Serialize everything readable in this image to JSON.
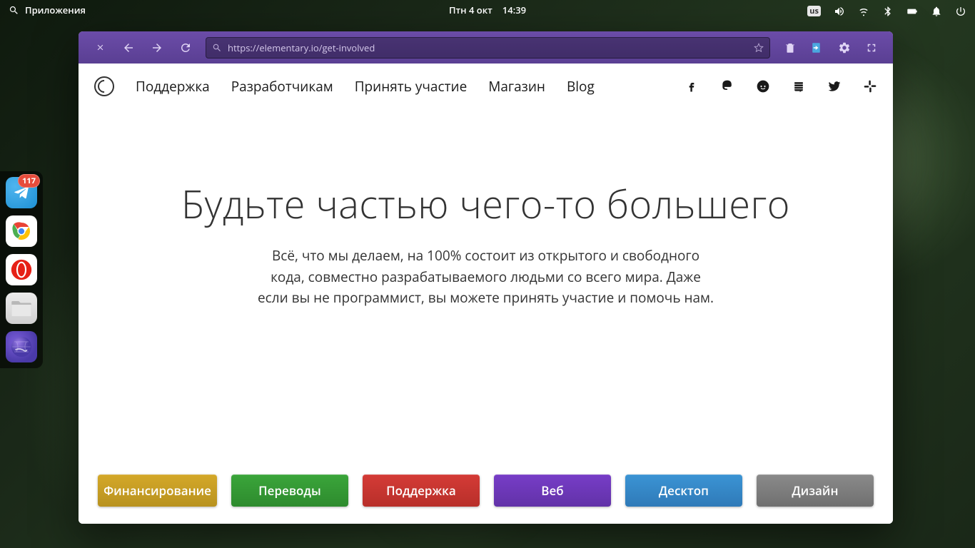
{
  "panel": {
    "apps_label": "Приложения",
    "date": "Птн  4 окт",
    "time": "14:39",
    "keyboard": "us"
  },
  "dock": {
    "telegram_badge": "117"
  },
  "browser": {
    "url": "https://elementary.io/get-involved"
  },
  "site": {
    "nav": {
      "support": "Поддержка",
      "developers": "Разработчикам",
      "get_involved": "Принять участие",
      "store": "Магазин",
      "blog": "Blog"
    },
    "hero": {
      "title": "Будьте частью чего-то большего",
      "subtitle": "Всё, что мы делаем, на 100% состоит из открытого и свободного кода, совместно разрабатываемого людьми со всего мира. Даже если вы не программист, вы можете принять участие и помочь нам."
    },
    "chips": {
      "funding": "Финансирование",
      "translations": "Переводы",
      "support": "Поддержка",
      "web": "Веб",
      "desktop": "Десктоп",
      "design": "Дизайн"
    }
  }
}
